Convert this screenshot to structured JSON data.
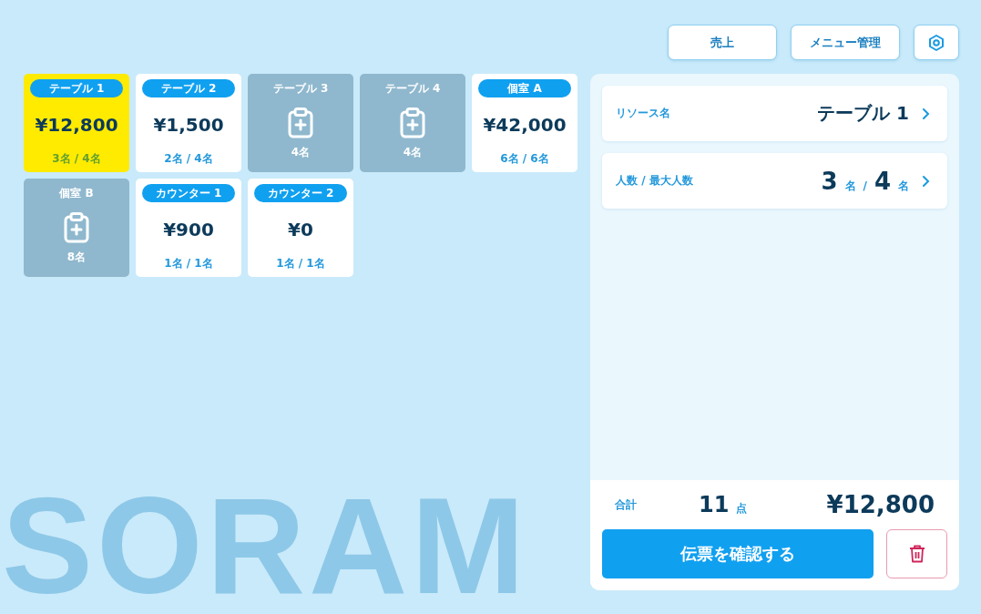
{
  "background_text": "SORAM",
  "toolbar": {
    "buttons": [
      "売上",
      "メニュー管理"
    ]
  },
  "resources": [
    {
      "kind": "occupied",
      "label": "テーブル 1",
      "amount": "¥12,800",
      "guests": "3名 / 4名",
      "selected": true
    },
    {
      "kind": "occupied",
      "label": "テーブル 2",
      "amount": "¥1,500",
      "guests": "2名 / 4名",
      "selected": false
    },
    {
      "kind": "vacant",
      "label": "テーブル 3",
      "capacity": "4名",
      "selected": false
    },
    {
      "kind": "vacant",
      "label": "テーブル 4",
      "capacity": "4名",
      "selected": false
    },
    {
      "kind": "occupied",
      "label": "個室 A",
      "amount": "¥42,000",
      "guests": "6名 / 6名",
      "selected": false
    },
    {
      "kind": "vacant",
      "label": "個室 B",
      "capacity": "8名",
      "selected": false
    },
    {
      "kind": "occupied",
      "label": "カウンター 1",
      "amount": "¥900",
      "guests": "1名 / 1名",
      "selected": false
    },
    {
      "kind": "occupied",
      "label": "カウンター 2",
      "amount": "¥0",
      "guests": "1名 / 1名",
      "selected": false
    }
  ],
  "detail": {
    "resource_label": "リソース名",
    "resource_value": "テーブル 1",
    "guests_label": "人数 / 最大人数",
    "guests": "3",
    "guests_unit": "名",
    "separator": "/",
    "max_guests": "4",
    "max_unit": "名"
  },
  "summary": {
    "total_label": "合計",
    "items": "11",
    "items_unit": "点",
    "total": "¥12,800",
    "confirm_button": "伝票を確認する"
  }
}
